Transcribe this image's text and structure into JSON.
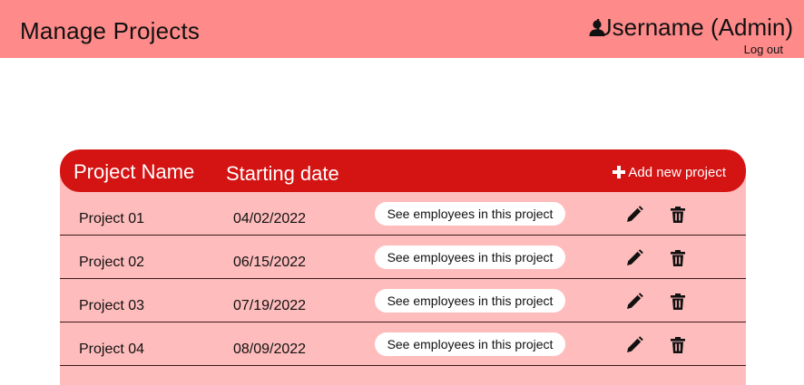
{
  "header": {
    "title": "Manage Projects",
    "username": "Username (Admin)",
    "logout_label": "Log out",
    "user_icon": "user-icon",
    "background": "#ff8a8a"
  },
  "table": {
    "columns": {
      "name": "Project Name",
      "date": "Starting date"
    },
    "add_label": "Add new project",
    "add_icon": "plus-icon",
    "header_color": "#d41313",
    "body_color": "#ffbcbc",
    "rows": [
      {
        "name": "Project 01",
        "date": "04/02/2022",
        "employees_label": "See employees in this project"
      },
      {
        "name": "Project 02",
        "date": "06/15/2022",
        "employees_label": "See employees in this project"
      },
      {
        "name": "Project 03",
        "date": "07/19/2022",
        "employees_label": "See employees in this project"
      },
      {
        "name": "Project 04",
        "date": "08/09/2022",
        "employees_label": "See employees in this project"
      }
    ],
    "row_icons": [
      "pencil-icon",
      "trash-icon"
    ]
  }
}
